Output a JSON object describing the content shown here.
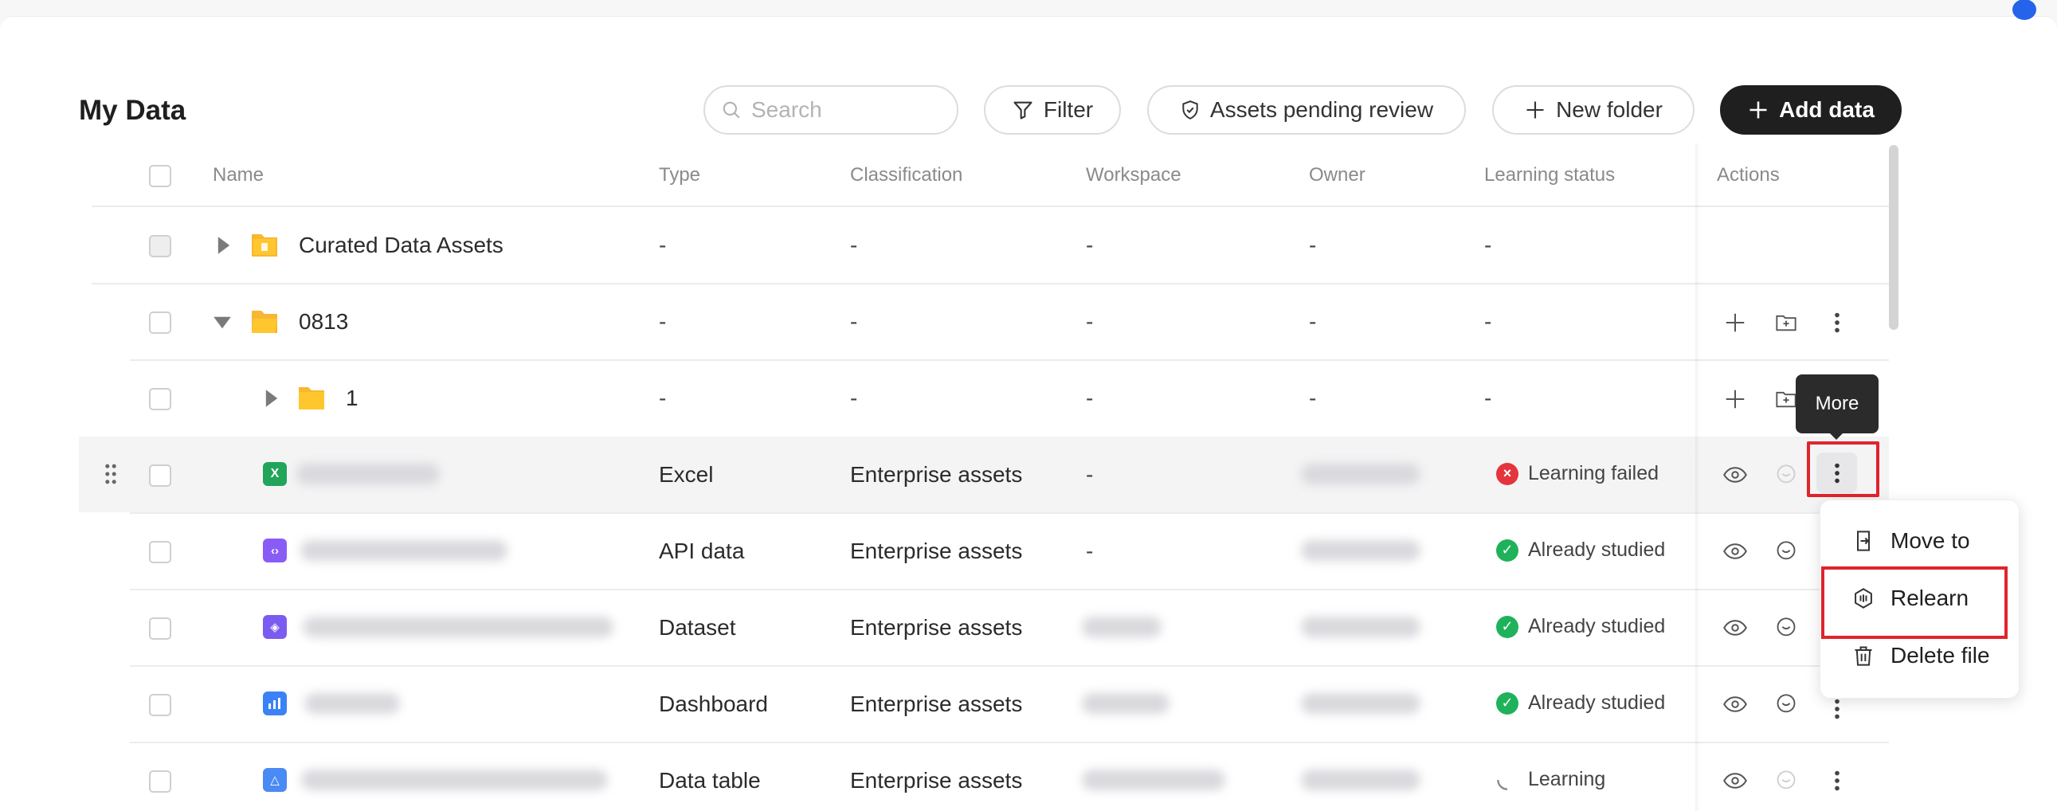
{
  "page": {
    "title": "My Data"
  },
  "toolbar": {
    "search_placeholder": "Search",
    "filter_label": "Filter",
    "pending_label": "Assets pending review",
    "new_folder_label": "New folder",
    "add_data_label": "Add data"
  },
  "table": {
    "columns": [
      "Name",
      "Type",
      "Classification",
      "Workspace",
      "Owner",
      "Learning status",
      "Actions"
    ],
    "rows": [
      {
        "name": "Curated Data Assets",
        "type": "-",
        "classification": "-",
        "workspace": "-",
        "owner": "-",
        "status": "-",
        "icon": "folder-special-icon",
        "expander": "collapsed"
      },
      {
        "name": "0813",
        "type": "-",
        "classification": "-",
        "workspace": "-",
        "owner": "-",
        "status": "-",
        "icon": "folder-open-icon",
        "expander": "expanded"
      },
      {
        "name": "1",
        "type": "-",
        "classification": "-",
        "workspace": "-",
        "owner": "-",
        "status": "-",
        "icon": "folder-icon",
        "expander": "collapsed"
      },
      {
        "name": "",
        "type": "Excel",
        "classification": "Enterprise assets",
        "workspace": "-",
        "owner": "",
        "status": "Learning failed",
        "icon": "excel-icon"
      },
      {
        "name": "",
        "type": "API data",
        "classification": "Enterprise assets",
        "workspace": "-",
        "owner": "",
        "status": "Already studied",
        "icon": "api-icon"
      },
      {
        "name": "",
        "type": "Dataset",
        "classification": "Enterprise assets",
        "workspace": "",
        "owner": "",
        "status": "Already studied",
        "icon": "dataset-icon"
      },
      {
        "name": "",
        "type": "Dashboard",
        "classification": "Enterprise assets",
        "workspace": "",
        "owner": "",
        "status": "Already studied",
        "icon": "dashboard-icon"
      },
      {
        "name": "",
        "type": "Data table",
        "classification": "Enterprise assets",
        "workspace": "",
        "owner": "",
        "status": "Learning",
        "icon": "data-table-icon"
      }
    ]
  },
  "tooltip": {
    "text": "More"
  },
  "context_menu": {
    "items": [
      {
        "label": "Move to",
        "icon": "move-to-icon"
      },
      {
        "label": "Relearn",
        "icon": "relearn-icon"
      },
      {
        "label": "Delete file",
        "icon": "trash-icon"
      }
    ]
  },
  "colors": {
    "accent": "#1f1f1f",
    "failed": "#e5343b",
    "success": "#1fb25a",
    "highlight": "#e0242c"
  }
}
